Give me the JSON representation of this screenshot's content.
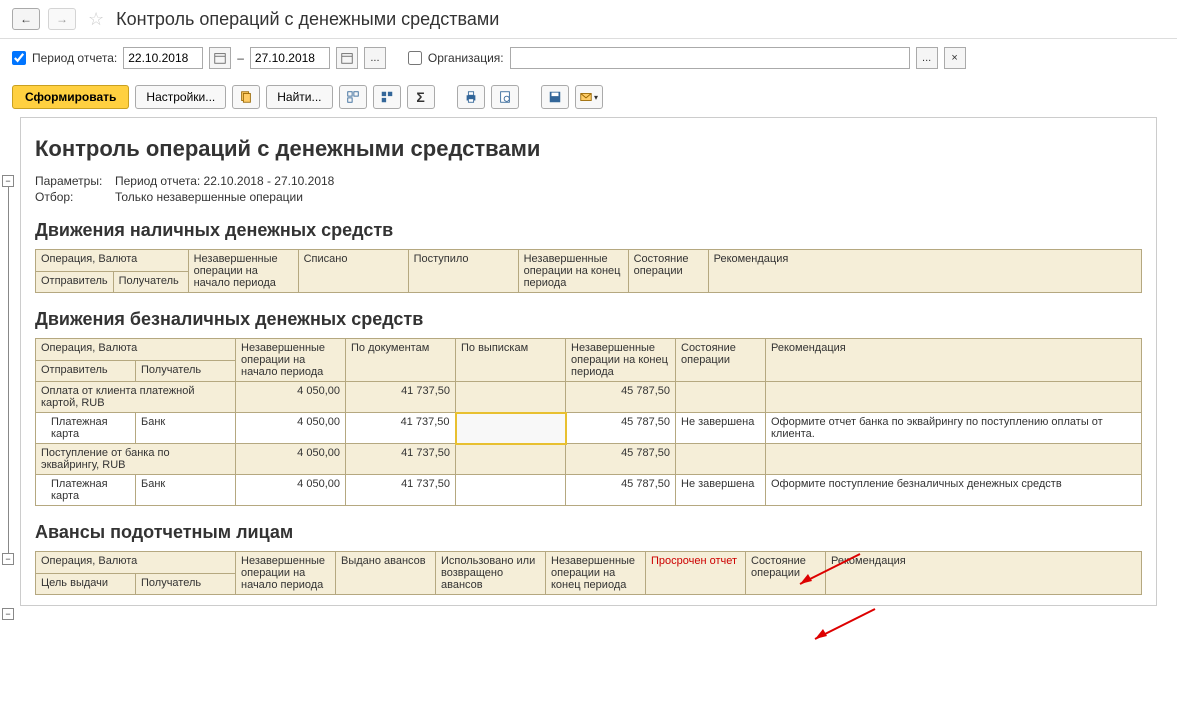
{
  "header": {
    "title": "Контроль операций с денежными средствами"
  },
  "filter": {
    "period_label": "Период отчета:",
    "date_from": "22.10.2018",
    "date_sep": "–",
    "date_to": "27.10.2018",
    "org_label": "Организация:",
    "dots": "...",
    "clear": "×"
  },
  "toolbar": {
    "generate": "Сформировать",
    "settings": "Настройки...",
    "find": "Найти..."
  },
  "report": {
    "title": "Контроль операций с денежными средствами",
    "params_label": "Параметры:",
    "params_value": "Период отчета: 22.10.2018 - 27.10.2018",
    "filter_label": "Отбор:",
    "filter_value": "Только незавершенные операции"
  },
  "section1": {
    "title": "Движения наличных денежных средств",
    "h1": "Операция, Валюта",
    "h2": "Незавершенные операции на начало периода",
    "h3": "Списано",
    "h4": "Поступило",
    "h5": "Незавершенные операции на конец периода",
    "h6": "Состояние операции",
    "h7": "Рекомендация",
    "h8": "Отправитель",
    "h9": "Получатель"
  },
  "section2": {
    "title": "Движения безналичных денежных средств",
    "h1": "Операция, Валюта",
    "h2": "Незавершенные операции на начало периода",
    "h3": "По документам",
    "h4": "По выпискам",
    "h5": "Незавершенные операции на конец периода",
    "h6": "Состояние операции",
    "h7": "Рекомендация",
    "h8": "Отправитель",
    "h9": "Получатель",
    "r1c1": "Оплата от клиента платежной картой, RUB",
    "r1c2": "4 050,00",
    "r1c3": "41 737,50",
    "r1c5": "45 787,50",
    "r2c1": "Платежная карта",
    "r2c1b": "Банк",
    "r2c2": "4 050,00",
    "r2c3": "41 737,50",
    "r2c5": "45 787,50",
    "r2c6": "Не завершена",
    "r2c7": "Оформите отчет банка по эквайрингу по поступлению оплаты от клиента.",
    "r3c1": "Поступление от банка по эквайрингу, RUB",
    "r3c2": "4 050,00",
    "r3c3": "41 737,50",
    "r3c5": "45 787,50",
    "r4c1": "Платежная карта",
    "r4c1b": "Банк",
    "r4c2": "4 050,00",
    "r4c3": "41 737,50",
    "r4c5": "45 787,50",
    "r4c6": "Не завершена",
    "r4c7": "Оформите поступление безналичных денежных средств"
  },
  "section3": {
    "title": "Авансы подотчетным лицам",
    "h1": "Операция, Валюта",
    "h2": "Незавершенные операции на начало периода",
    "h3": "Выдано авансов",
    "h4": "Использовано или возвращено авансов",
    "h5": "Незавершенные операции на конец периода",
    "h6": "Просрочен отчет",
    "h7": "Состояние операции",
    "h8": "Рекомендация",
    "h9": "Цель выдачи",
    "h10": "Получатель"
  }
}
